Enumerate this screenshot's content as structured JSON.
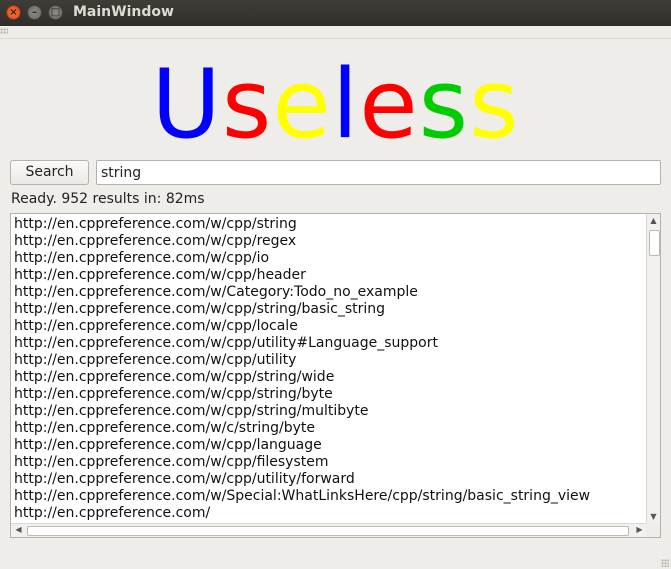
{
  "window": {
    "title": "MainWindow",
    "close_glyph": "×",
    "minimize_glyph": "–",
    "maximize_glyph": "□"
  },
  "logo": {
    "letters": [
      "U",
      "s",
      "e",
      "l",
      "e",
      "s",
      "s"
    ],
    "colors": [
      "#0000ff",
      "#ff0000",
      "#ffff00",
      "#0000ff",
      "#ff0000",
      "#00cc00",
      "#ffff00"
    ]
  },
  "search": {
    "button_label": "Search",
    "query": "string"
  },
  "status": "Ready. 952 results in: 82ms",
  "results": [
    "http://en.cppreference.com/w/cpp/string",
    "http://en.cppreference.com/w/cpp/regex",
    "http://en.cppreference.com/w/cpp/io",
    "http://en.cppreference.com/w/cpp/header",
    "http://en.cppreference.com/w/Category:Todo_no_example",
    "http://en.cppreference.com/w/cpp/string/basic_string",
    "http://en.cppreference.com/w/cpp/locale",
    "http://en.cppreference.com/w/cpp/utility#Language_support",
    "http://en.cppreference.com/w/cpp/utility",
    "http://en.cppreference.com/w/cpp/string/wide",
    "http://en.cppreference.com/w/cpp/string/byte",
    "http://en.cppreference.com/w/cpp/string/multibyte",
    "http://en.cppreference.com/w/c/string/byte",
    "http://en.cppreference.com/w/cpp/language",
    "http://en.cppreference.com/w/cpp/filesystem",
    "http://en.cppreference.com/w/cpp/utility/forward",
    "http://en.cppreference.com/w/Special:WhatLinksHere/cpp/string/basic_string_view",
    "http://en.cppreference.com/"
  ],
  "scrollbar": {
    "up_glyph": "▲",
    "down_glyph": "▼",
    "left_glyph": "◀",
    "right_glyph": "▶"
  }
}
